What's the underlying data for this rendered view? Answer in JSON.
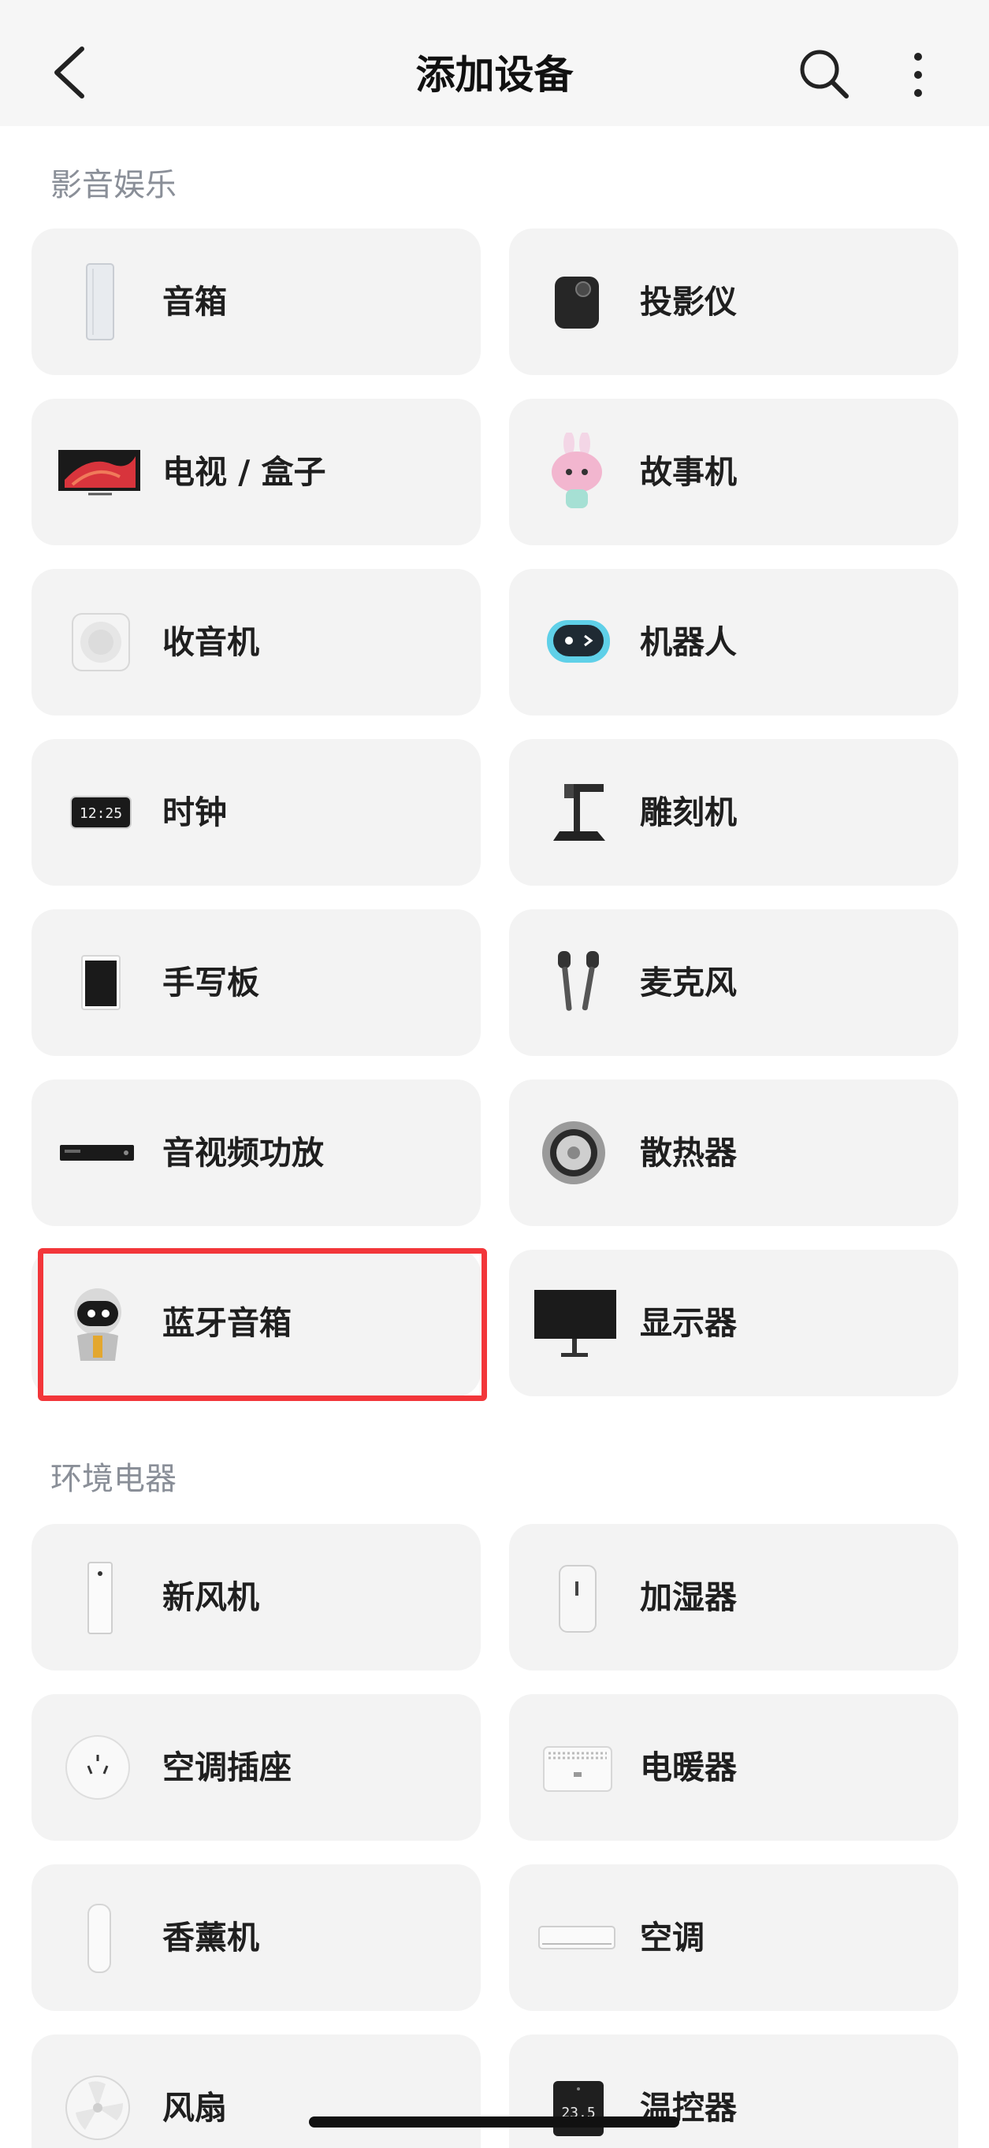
{
  "header": {
    "title": "添加设备"
  },
  "sections": [
    {
      "title": "影音娱乐",
      "items": [
        {
          "label": "音箱",
          "icon": "speaker-icon"
        },
        {
          "label": "投影仪",
          "icon": "projector-icon"
        },
        {
          "label": "电视 / 盒子",
          "icon": "tv-icon"
        },
        {
          "label": "故事机",
          "icon": "story-machine-icon"
        },
        {
          "label": "收音机",
          "icon": "radio-icon"
        },
        {
          "label": "机器人",
          "icon": "robot-icon"
        },
        {
          "label": "时钟",
          "icon": "clock-icon"
        },
        {
          "label": "雕刻机",
          "icon": "engraver-icon"
        },
        {
          "label": "手写板",
          "icon": "writing-tablet-icon"
        },
        {
          "label": "麦克风",
          "icon": "microphone-icon"
        },
        {
          "label": "音视频功放",
          "icon": "amplifier-icon"
        },
        {
          "label": "散热器",
          "icon": "cooler-icon"
        },
        {
          "label": "蓝牙音箱",
          "icon": "bluetooth-speaker-icon"
        },
        {
          "label": "显示器",
          "icon": "monitor-icon"
        }
      ]
    },
    {
      "title": "环境电器",
      "items": [
        {
          "label": "新风机",
          "icon": "fresh-air-icon"
        },
        {
          "label": "加湿器",
          "icon": "humidifier-icon"
        },
        {
          "label": "空调插座",
          "icon": "ac-socket-icon"
        },
        {
          "label": "电暖器",
          "icon": "heater-icon"
        },
        {
          "label": "香薰机",
          "icon": "aroma-diffuser-icon"
        },
        {
          "label": "空调",
          "icon": "air-conditioner-icon"
        },
        {
          "label": "风扇",
          "icon": "fan-icon"
        },
        {
          "label": "温控器",
          "icon": "thermostat-icon"
        }
      ]
    }
  ],
  "thermostat_display": "23.5",
  "clock_display": "12:25",
  "highlight_color": "#f2363a"
}
